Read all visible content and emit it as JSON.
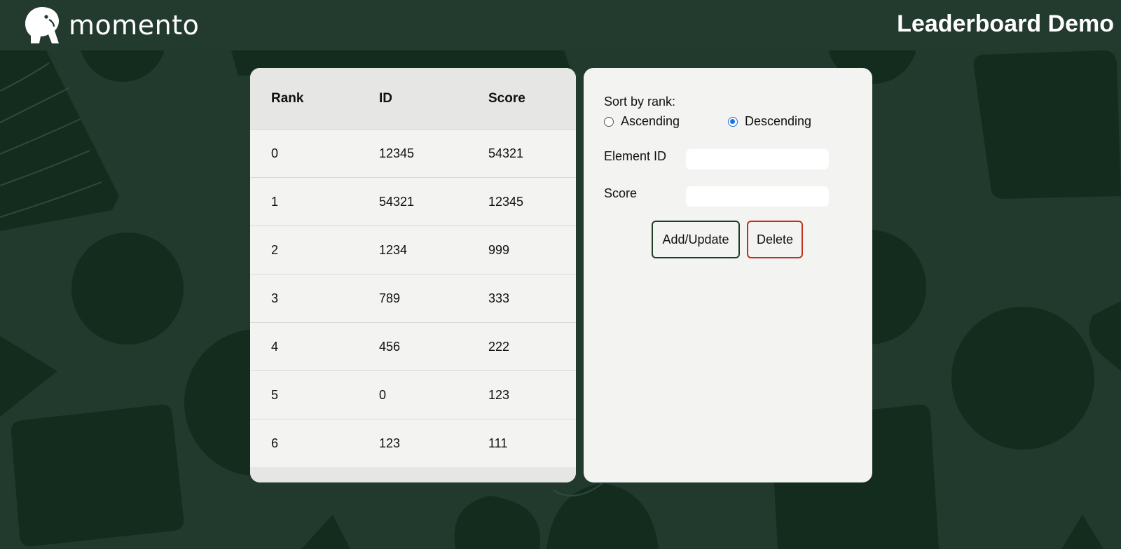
{
  "header": {
    "brand": "momento",
    "title": "Leaderboard Demo"
  },
  "leaderboard": {
    "columns": [
      "Rank",
      "ID",
      "Score"
    ],
    "rows": [
      {
        "rank": "0",
        "id": "12345",
        "score": "54321"
      },
      {
        "rank": "1",
        "id": "54321",
        "score": "12345"
      },
      {
        "rank": "2",
        "id": "1234",
        "score": "999"
      },
      {
        "rank": "3",
        "id": "789",
        "score": "333"
      },
      {
        "rank": "4",
        "id": "456",
        "score": "222"
      },
      {
        "rank": "5",
        "id": "0",
        "score": "123"
      },
      {
        "rank": "6",
        "id": "123",
        "score": "111"
      }
    ]
  },
  "controls": {
    "sort_label": "Sort by rank:",
    "sort_options": [
      {
        "label": "Ascending",
        "checked": false
      },
      {
        "label": "Descending",
        "checked": true
      }
    ],
    "element_id_label": "Element ID",
    "element_id_value": "",
    "score_label": "Score",
    "score_value": "",
    "add_update_label": "Add/Update",
    "delete_label": "Delete"
  },
  "colors": {
    "background": "#223a2d",
    "background_shapes": "#142c1e",
    "panel": "#f3f3f2",
    "table_header": "#e6e6e4",
    "add_border": "#1f3f24",
    "delete_border": "#c0301e",
    "radio_accent": "#1a73e8"
  },
  "icons": {
    "logo": "momento-logo-icon"
  }
}
